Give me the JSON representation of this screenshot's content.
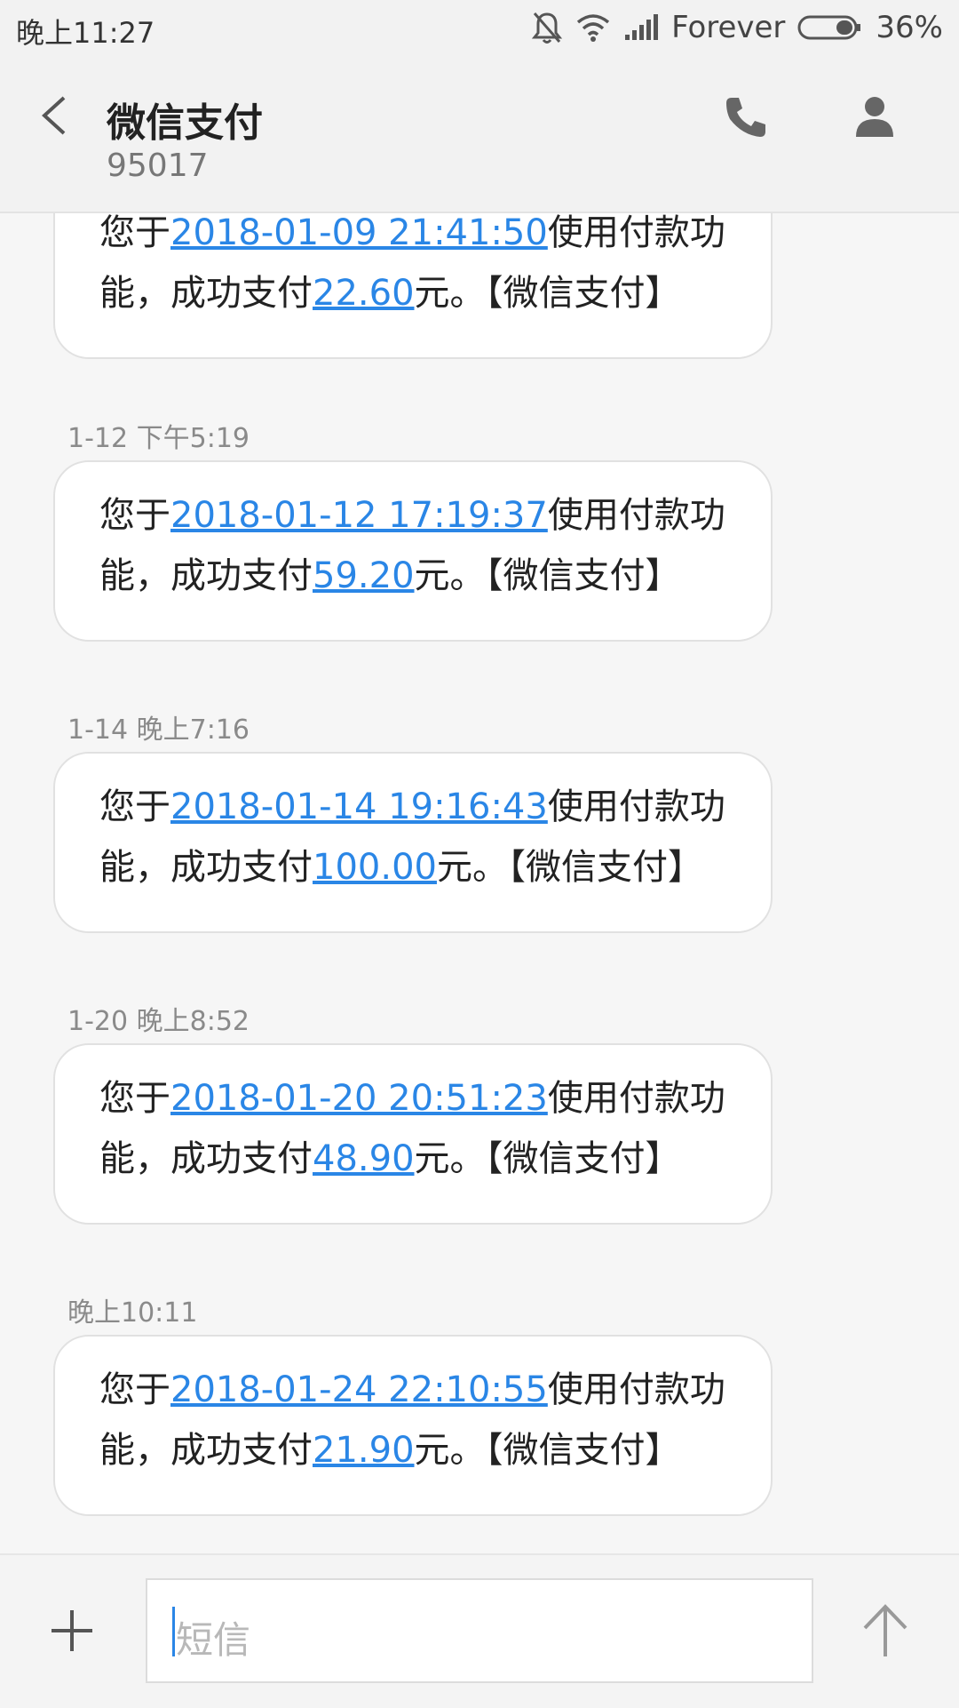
{
  "status_bar": {
    "time": "晚上11:27",
    "carrier": "Forever",
    "battery": "36%"
  },
  "header": {
    "title": "微信支付",
    "number": "95017"
  },
  "messages": [
    {
      "timestamp": "",
      "prefix": "您于",
      "datetime": "2018-01-09 21:41:50",
      "mid": "使用付款功能，成功支付",
      "amount": "22.60",
      "suffix": "元。【微信支付】"
    },
    {
      "timestamp": "1-12 下午5:19",
      "prefix": "您于",
      "datetime": "2018-01-12 17:19:37",
      "mid": "使用付款功能，成功支付",
      "amount": "59.20",
      "suffix": "元。【微信支付】"
    },
    {
      "timestamp": "1-14 晚上7:16",
      "prefix": "您于",
      "datetime": "2018-01-14 19:16:43",
      "mid": "使用付款功能，成功支付",
      "amount": "100.00",
      "suffix": "元。【微信支付】"
    },
    {
      "timestamp": "1-20 晚上8:52",
      "prefix": "您于",
      "datetime": "2018-01-20 20:51:23",
      "mid": "使用付款功能，成功支付",
      "amount": "48.90",
      "suffix": "元。【微信支付】"
    },
    {
      "timestamp": "晚上10:11",
      "prefix": "您于",
      "datetime": "2018-01-24 22:10:55",
      "mid": "使用付款功能，成功支付",
      "amount": "21.90",
      "suffix": "元。【微信支付】"
    }
  ],
  "compose": {
    "placeholder": "短信"
  },
  "colors": {
    "link": "#2a86e6",
    "background": "#f6f6f6",
    "bubble": "#ffffff"
  }
}
